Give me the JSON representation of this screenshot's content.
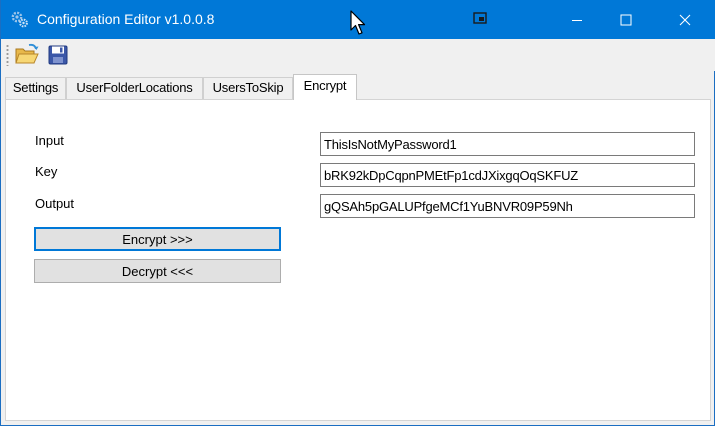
{
  "window": {
    "title": "Configuration Editor v1.0.0.8",
    "accent_color": "#0078d7",
    "icon": "gears-icon",
    "controls": [
      "minimize-icon",
      "maximize-icon",
      "close-icon"
    ]
  },
  "toolbar": {
    "items": [
      {
        "icon": "open-folder-icon",
        "tooltip": ""
      },
      {
        "icon": "save-disk-icon",
        "tooltip": ""
      }
    ]
  },
  "tabs": [
    {
      "label": "Settings",
      "active": false
    },
    {
      "label": "UserFolderLocations",
      "active": false
    },
    {
      "label": "UsersToSkip",
      "active": false
    },
    {
      "label": "Encrypt",
      "active": true
    }
  ],
  "encrypt": {
    "input_label": "Input",
    "input_value": "ThisIsNotMyPassword1",
    "key_label": "Key",
    "key_value": "bRK92kDpCqpnPMEtFp1cdJXixgqOqSKFUZ",
    "output_label": "Output",
    "output_value": "gQSAh5pGALUPfgeMCf1YuBNVR09P59Nh",
    "encrypt_button": "Encrypt >>>",
    "decrypt_button": "Decrypt <<<"
  }
}
